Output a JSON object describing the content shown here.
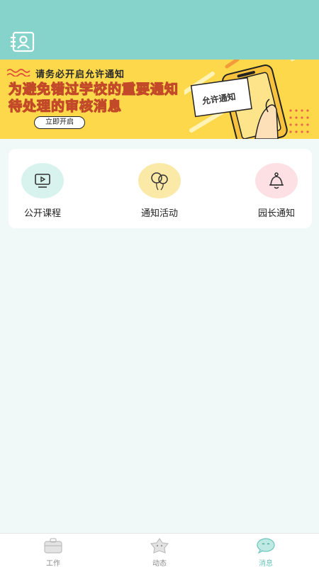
{
  "banner": {
    "subtitle": "请务必开启允许通知",
    "title_line1": "为避免错过学校的重要通知",
    "title_line2": "待处理的审核消息",
    "button_label": "立即开启",
    "card_text": "允许通知"
  },
  "quick_actions": [
    {
      "label": "公开课程",
      "icon": "video-play-icon",
      "color": "#d8f3ee"
    },
    {
      "label": "通知活动",
      "icon": "balloon-icon",
      "color": "#fbeaa7"
    },
    {
      "label": "园长通知",
      "icon": "bell-icon",
      "color": "#fde0e3"
    }
  ],
  "tabbar": [
    {
      "label": "工作",
      "icon": "briefcase-icon",
      "active": false
    },
    {
      "label": "动态",
      "icon": "star-face-icon",
      "active": false
    },
    {
      "label": "消息",
      "icon": "chat-bubble-icon",
      "active": true
    }
  ],
  "colors": {
    "header": "#85d3cb",
    "banner": "#fcd84a",
    "accent": "#6cc6bd"
  }
}
